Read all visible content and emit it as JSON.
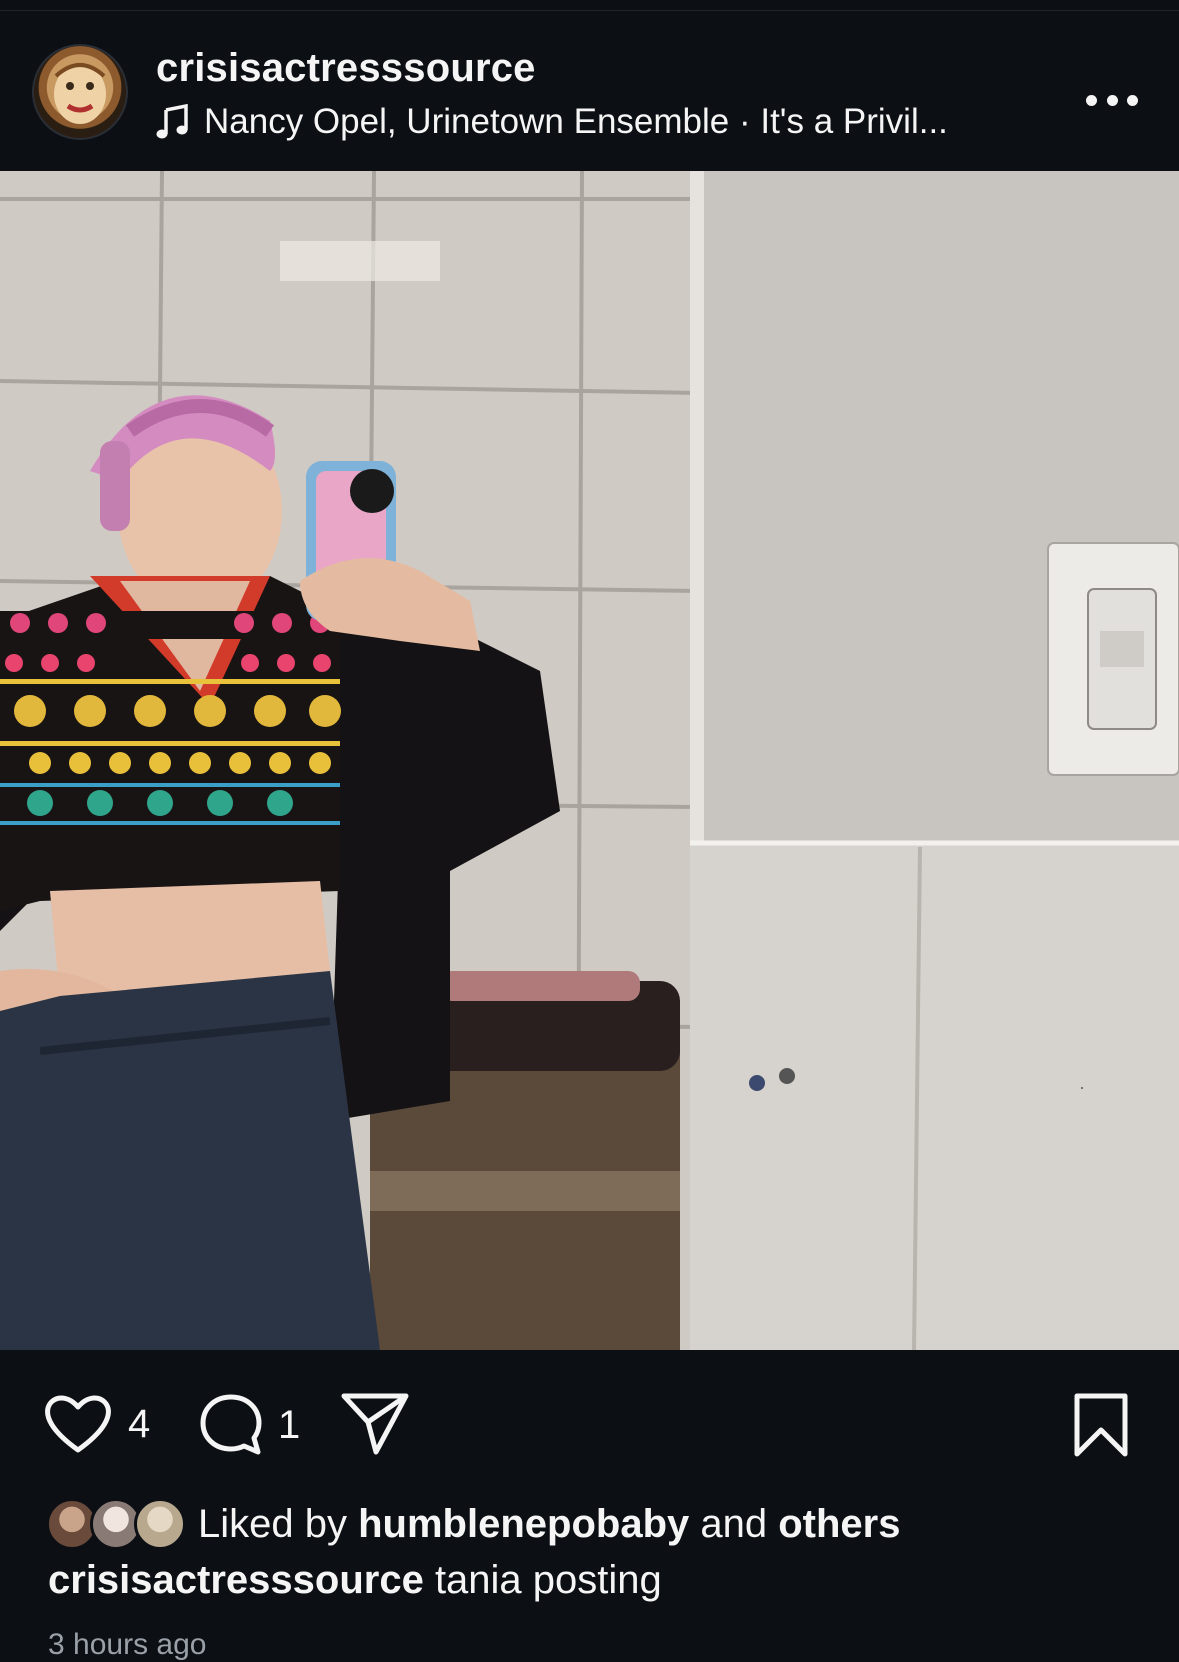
{
  "post": {
    "username": "crisisactresssource",
    "audio": "Nancy Opel, Urinetown Ensemble · It's a Privil..."
  },
  "actions": {
    "like_count": "4",
    "comment_count": "1"
  },
  "likes": {
    "prefix": "Liked by ",
    "user": "humblenepobaby",
    "middle": " and ",
    "others": "others"
  },
  "caption": {
    "username": "crisisactresssource",
    "text": " tania posting"
  },
  "timestamp": "3 hours ago",
  "icons": {
    "more": "more-horizontal-icon",
    "music": "music-note-icon",
    "mute": "volume-muted-icon",
    "like": "heart-icon",
    "comment": "comment-bubble-icon",
    "share": "paper-plane-icon",
    "save": "bookmark-icon"
  },
  "colors": {
    "background": "#0c0f14",
    "text": "#f5f5f5",
    "secondary_text": "#9aa0a8"
  }
}
